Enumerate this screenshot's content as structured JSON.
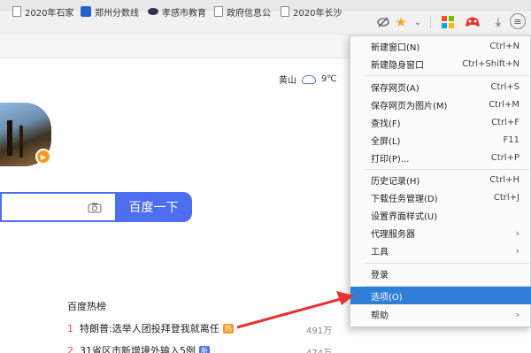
{
  "toolbar": {
    "icons": [
      "eye-off-icon",
      "star-icon",
      "chevron-down-icon",
      "apps-grid-icon",
      "game-icon",
      "download-icon",
      "menu-icon"
    ],
    "star_color": "#f5a623"
  },
  "bookmarks": [
    {
      "label": "2020年石家",
      "icon": "page"
    },
    {
      "label": "郑州分数线",
      "icon": "badge"
    },
    {
      "label": "孝感市教育",
      "icon": "eye"
    },
    {
      "label": "政府信息公",
      "icon": "page"
    },
    {
      "label": "2020年长沙",
      "icon": "page"
    }
  ],
  "weather": {
    "city": "黄山",
    "temp": "9℃"
  },
  "search": {
    "button_label": "百度一下",
    "value": ""
  },
  "hot": {
    "title": "百度热榜",
    "items": [
      {
        "rank": "1",
        "text": "特朗普:选举人团投拜登我就离任",
        "tag": "热",
        "tag_color": "#f29b1f",
        "count": "491万"
      },
      {
        "rank": "2",
        "text": "31省区市新增境外输入5例",
        "tag": "新",
        "tag_color": "#4e6ef2",
        "count": "474万"
      }
    ]
  },
  "menu": {
    "items": [
      {
        "label": "新建窗口(N)",
        "shortcut": "Ctrl+N"
      },
      {
        "label": "新建隐身窗口",
        "shortcut": "Ctrl+Shift+N"
      },
      {
        "label": "保存网页(A)",
        "shortcut": "Ctrl+S"
      },
      {
        "label": "保存网页为图片(M)",
        "shortcut": "Ctrl+M"
      },
      {
        "label": "查找(F)",
        "shortcut": "Ctrl+F"
      },
      {
        "label": "全屏(L)",
        "shortcut": "F11"
      },
      {
        "label": "打印(P)...",
        "shortcut": "Ctrl+P"
      },
      {
        "label": "历史记录(H)",
        "shortcut": "Ctrl+H"
      },
      {
        "label": "下载任务管理(D)",
        "shortcut": "Ctrl+J"
      },
      {
        "label": "设置界面样式(U)",
        "shortcut": ""
      },
      {
        "label": "代理服务器",
        "shortcut": "›"
      },
      {
        "label": "工具",
        "shortcut": "›"
      },
      {
        "label": "登录",
        "shortcut": ""
      },
      {
        "label": "选项(O)",
        "shortcut": ""
      },
      {
        "label": "帮助",
        "shortcut": "›"
      }
    ],
    "highlight_color": "#2f7fd9"
  },
  "annotation": {
    "arrow_color": "#e8322f"
  }
}
